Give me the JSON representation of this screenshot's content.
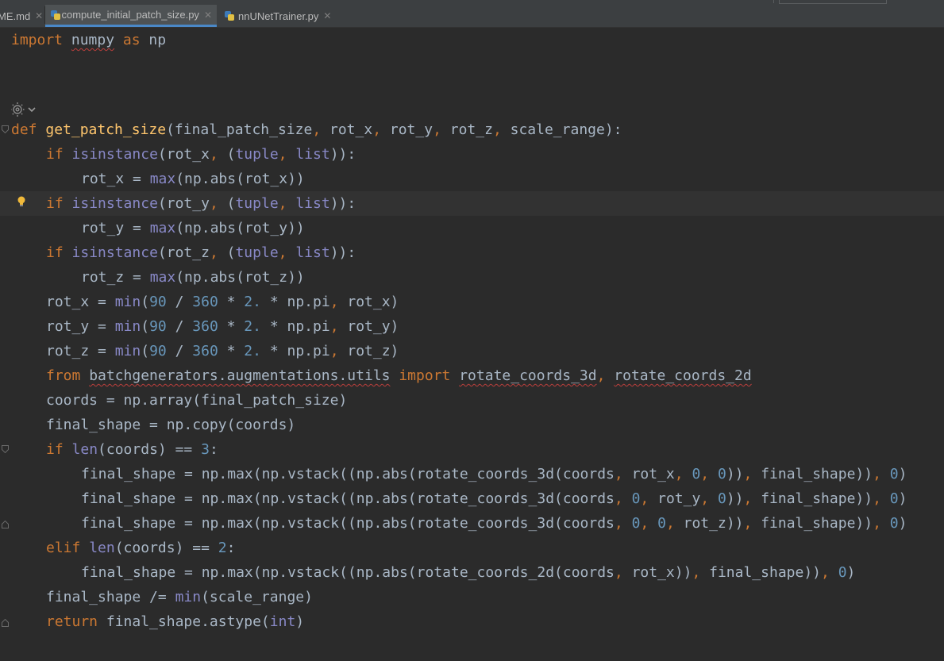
{
  "tabs": [
    {
      "label": "ME.md",
      "active": false
    },
    {
      "label": "compute_initial_patch_size.py",
      "active": true
    },
    {
      "label": "nnUNetTrainer.py",
      "active": false
    }
  ],
  "colors": {
    "background": "#2b2b2b",
    "keyword": "#cc7832",
    "function_def": "#ffc66d",
    "builtin": "#8888c6",
    "number": "#6897bb",
    "default_text": "#a9b7c6",
    "active_tab_underline": "#4a88c7"
  },
  "icons": [
    "python-file-icon",
    "close-icon",
    "gutter-gear-icon",
    "chevron-down-icon",
    "fold-icon",
    "intention-bulb-icon"
  ],
  "code": {
    "l1": {
      "a": "import",
      "b": " ",
      "c": "numpy",
      "d": " ",
      "e": "as",
      "f": " np"
    },
    "l2": {
      "a": "def",
      "b": " ",
      "c": "get_patch_size",
      "d": "(final_patch_size",
      "e": ",",
      "f": " rot_x",
      "g": ",",
      "h": " rot_y",
      "i": ",",
      "j": " rot_z",
      "k": ",",
      "l": " scale_range):"
    },
    "l3": {
      "a": "if",
      "b": " ",
      "c": "isinstance",
      "d": "(rot_x",
      "e": ",",
      "f": " (",
      "g": "tuple",
      "h": ",",
      "i": " ",
      "j": "list",
      "k": ")):"
    },
    "l4": {
      "a": "rot_x = ",
      "b": "max",
      "c": "(np.abs(rot_x))"
    },
    "l5": {
      "a": "if",
      "b": " ",
      "c": "isinstance",
      "d": "(rot_y",
      "e": ",",
      "f": " (",
      "g": "tuple",
      "h": ",",
      "i": " ",
      "j": "list",
      "k": ")):"
    },
    "l6": {
      "a": "rot_y = ",
      "b": "max",
      "c": "(np.abs(rot_y))"
    },
    "l7": {
      "a": "if",
      "b": " ",
      "c": "isinstance",
      "d": "(rot_z",
      "e": ",",
      "f": " (",
      "g": "tuple",
      "h": ",",
      "i": " ",
      "j": "list",
      "k": ")):"
    },
    "l8": {
      "a": "rot_z = ",
      "b": "max",
      "c": "(np.abs(rot_z))"
    },
    "l9": {
      "a": "rot_x = ",
      "b": "min",
      "c": "(",
      "d": "90",
      "e": " / ",
      "f": "360",
      "g": " * ",
      "h": "2.",
      "i": " * np.pi",
      "j": ",",
      "k": " rot_x)"
    },
    "l10": {
      "a": "rot_y = ",
      "b": "min",
      "c": "(",
      "d": "90",
      "e": " / ",
      "f": "360",
      "g": " * ",
      "h": "2.",
      "i": " * np.pi",
      "j": ",",
      "k": " rot_y)"
    },
    "l11": {
      "a": "rot_z = ",
      "b": "min",
      "c": "(",
      "d": "90",
      "e": " / ",
      "f": "360",
      "g": " * ",
      "h": "2.",
      "i": " * np.pi",
      "j": ",",
      "k": " rot_z)"
    },
    "l12": {
      "a": "from",
      "b": " ",
      "c": "batchgenerators.augmentations.utils",
      "d": " ",
      "e": "import",
      "f": " ",
      "g": "rotate_coords_3d",
      "h": ",",
      "i": " ",
      "j": "rotate_coords_2d"
    },
    "l13": {
      "a": "coords = np.array(final_patch_size)"
    },
    "l14": {
      "a": "final_shape = np.copy(coords)"
    },
    "l15": {
      "a": "if",
      "b": " ",
      "c": "len",
      "d": "(coords) == ",
      "e": "3",
      "f": ":"
    },
    "l16": {
      "a": "final_shape = np.max(np.vstack((np.abs(rotate_coords_3d(coords",
      "b": ",",
      "c": " rot_x",
      "d": ",",
      "e": " ",
      "f": "0",
      "g": ",",
      "h": " ",
      "i": "0",
      "j": "))",
      "k": ",",
      "l": " final_shape))",
      "m": ",",
      "n": " ",
      "o": "0",
      "p": ")"
    },
    "l17": {
      "a": "final_shape = np.max(np.vstack((np.abs(rotate_coords_3d(coords",
      "b": ",",
      "c": " ",
      "d": "0",
      "e": ",",
      "f": " rot_y",
      "g": ",",
      "h": " ",
      "i": "0",
      "j": "))",
      "k": ",",
      "l": " final_shape))",
      "m": ",",
      "n": " ",
      "o": "0",
      "p": ")"
    },
    "l18": {
      "a": "final_shape = np.max(np.vstack((np.abs(rotate_coords_3d(coords",
      "b": ",",
      "c": " ",
      "d": "0",
      "e": ",",
      "f": " ",
      "g": "0",
      "h": ",",
      "i": " rot_z",
      "j": "))",
      "k": ",",
      "l": " final_shape))",
      "m": ",",
      "n": " ",
      "o": "0",
      "p": ")"
    },
    "l19": {
      "a": "elif",
      "b": " ",
      "c": "len",
      "d": "(coords) == ",
      "e": "2",
      "f": ":"
    },
    "l20": {
      "a": "final_shape = np.max(np.vstack((np.abs(rotate_coords_2d(coords",
      "b": ",",
      "c": " rot_x))",
      "d": ",",
      "e": " final_shape))",
      "f": ",",
      "g": " ",
      "h": "0",
      "i": ")"
    },
    "l21": {
      "a": "final_shape /= ",
      "b": "min",
      "c": "(scale_range)"
    },
    "l22": {
      "a": "return",
      "b": " final_shape.astype(",
      "c": "int",
      "d": ")"
    }
  }
}
